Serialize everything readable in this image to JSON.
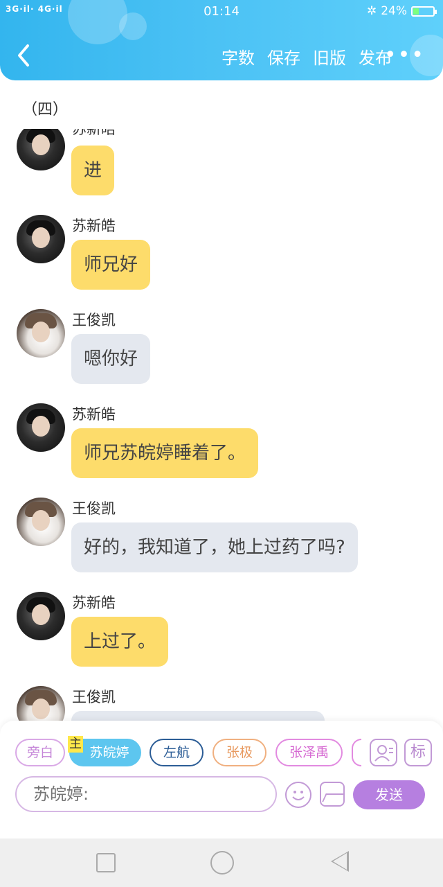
{
  "status_bar": {
    "network": "3G·il· 4G·il",
    "time": "01:14",
    "bluetooth": "✲",
    "battery": "24%"
  },
  "toolbar": {
    "back_icon": "back-arrow-icon",
    "items": [
      "字数",
      "保存",
      "旧版",
      "发布"
    ],
    "more": "•••"
  },
  "section_title": "（四）",
  "messages": [
    {
      "name": "",
      "text": "进",
      "speaker": "苏新皓"
    },
    {
      "name": "苏新皓",
      "text": "师兄好"
    },
    {
      "name": "王俊凯",
      "text": "嗯你好"
    },
    {
      "name": "苏新皓",
      "text": "师兄苏皖婷睡着了。"
    },
    {
      "name": "王俊凯",
      "text": "好的，我知道了，她上过药了吗?"
    },
    {
      "name": "苏新皓",
      "text": "上过了。"
    },
    {
      "name": "王俊凯",
      "text": ""
    }
  ],
  "roles": {
    "narration": "旁白",
    "main_tag": "主",
    "main": "苏皖婷",
    "r1": "左航",
    "r2": "张极",
    "r3": "张泽禹",
    "tag_btn": "标",
    "person_icon": "person-card-icon"
  },
  "composer": {
    "placeholder": "苏皖婷:",
    "emoji_icon": "smiley-icon",
    "image_icon": "image-icon",
    "send": "发送"
  },
  "colors": {
    "header": "#4ac1f4",
    "bubble_self": "#fddc6b",
    "bubble_other": "#e4e8ef",
    "send": "#b67fe0"
  }
}
